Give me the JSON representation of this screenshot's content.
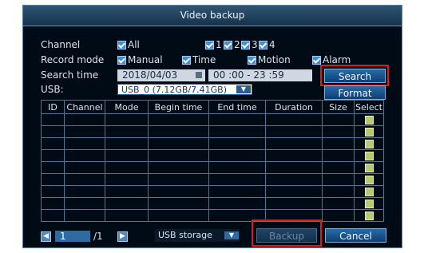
{
  "dialog": {
    "title": "Video backup"
  },
  "filters": {
    "channel_label": "Channel",
    "channel_options": [
      "All",
      "1",
      "2",
      "3",
      "4"
    ],
    "record_mode_label": "Record mode",
    "record_modes": [
      "Manual",
      "Time",
      "Motion",
      "Alarm"
    ],
    "search_time_label": "Search time",
    "date": "2018/04/03",
    "time_range": "00 :00 - 23 :59",
    "usb_label": "USB:",
    "usb_value": "USB_0  (7.12GB/7.41GB)"
  },
  "buttons": {
    "search": "Search",
    "format": "Format",
    "backup": "Backup",
    "cancel": "Cancel"
  },
  "table": {
    "columns": [
      "ID",
      "Channel",
      "Mode",
      "Begin time",
      "End time",
      "Duration",
      "Size",
      "Select"
    ],
    "row_count": 9
  },
  "pager": {
    "page": "1",
    "total": "/1"
  },
  "storage": {
    "value": "USB storage"
  },
  "icons": {
    "prev": "prev-page-icon",
    "next": "next-page-icon",
    "calendar": "calendar-icon",
    "dropdown": "chevron-down-icon"
  }
}
